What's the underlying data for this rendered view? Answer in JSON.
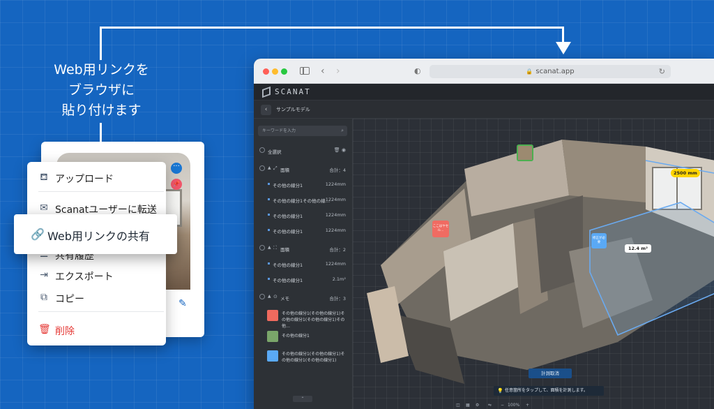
{
  "caption": {
    "line1": "Web用リンクを",
    "line2": "ブラウザに",
    "line3": "貼り付けます"
  },
  "browser": {
    "url": "scanat.app",
    "icons": {
      "back": "chevron-left-icon",
      "forward": "chevron-right-icon",
      "shield": "shield-icon",
      "reload": "reload-icon",
      "lock": "lock-icon"
    }
  },
  "app": {
    "logo_text": "SCANAT",
    "model_title": "サンプルモデル",
    "search_placeholder": "キーワードを入力",
    "select_all": "全選択",
    "groups": [
      {
        "label": "面積",
        "total": "合計：4",
        "items": [
          {
            "label": "その他の線分1",
            "value": "1224mm"
          },
          {
            "label": "その他の線分1その他の線…",
            "value": "1224mm"
          },
          {
            "label": "その他の線分1",
            "value": "1224mm"
          },
          {
            "label": "その他の線分1",
            "value": "1224mm"
          }
        ]
      },
      {
        "label": "面積",
        "total": "合計：2",
        "items": [
          {
            "label": "その他の線分1",
            "value": "1224mm"
          },
          {
            "label": "その他の線分1",
            "value": "2.1m²"
          }
        ]
      },
      {
        "label": "メモ",
        "total": "合計：3",
        "memos": [
          {
            "text": "その他の線分1(その他の線分1)その他の線分1(その他の線分1)その他…",
            "color": "#ef6a5e"
          },
          {
            "text": "その他の線分1",
            "color": "#7aa66a"
          },
          {
            "text": "その他の線分1(その他の線分1)その他の線分1(その他の線分1)",
            "color": "#5aa9f5"
          }
        ]
      }
    ],
    "viewport": {
      "measure_length": "2500 mm",
      "area": "12.4 m²",
      "pin_red_text": "ここはヤセル…",
      "pin_blue_text": "修正が必要",
      "measure_cancel": "計測取消",
      "hint": "任意箇所をタップして、面積を計測します。",
      "zoom": "100%"
    }
  },
  "menu": {
    "items": [
      {
        "label": "アップロード",
        "icon": "upload-icon"
      },
      {
        "label": "Scanatユーザーに転送",
        "icon": "transfer-icon"
      },
      {
        "label": "共有履歴",
        "icon": "history-icon"
      },
      {
        "label": "エクスポート",
        "icon": "export-icon"
      },
      {
        "label": "コピー",
        "icon": "copy-icon"
      },
      {
        "label": "削除",
        "icon": "trash-icon"
      }
    ],
    "highlight_label": "Web用リンクの共有",
    "highlight_icon": "link-icon"
  },
  "colors": {
    "background": "#1565c0",
    "accent": "#1976d2",
    "danger": "#e53935",
    "measure": "#ffd400"
  }
}
